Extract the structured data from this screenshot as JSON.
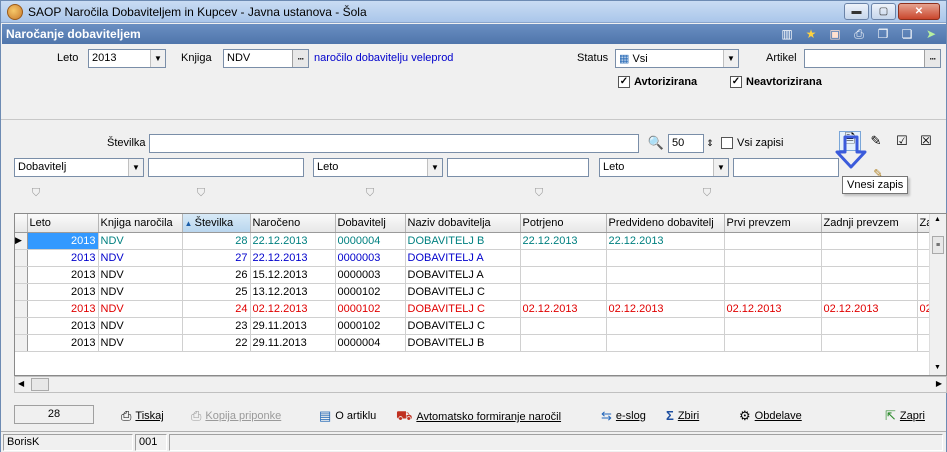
{
  "window": {
    "title": "SAOP Naročila Dobaviteljem in Kupcev - Javna ustanova - Šola",
    "minimize": "▬",
    "maximize": "▢",
    "close": "✕"
  },
  "header": {
    "title": "Naročanje dobaviteljem"
  },
  "form": {
    "leto_label": "Leto",
    "leto_value": "2013",
    "knjiga_label": "Knjiga",
    "knjiga_value": "NDV",
    "knjiga_desc": "naročilo dobavitelju veleprod",
    "status_label": "Status",
    "status_value": "Vsi",
    "artikel_label": "Artikel",
    "artikel_value": "",
    "avtorizirana_label": "Avtorizirana",
    "avtorizirana_checked": "✓",
    "neavtorizirana_label": "Neavtorizirana",
    "neavtorizirana_checked": "✓"
  },
  "search": {
    "stevilka_label": "Številka",
    "stevilka_value": "",
    "count_value": "50",
    "vsi_zapisi_label": "Vsi zapisi"
  },
  "filters": {
    "f1_field": "Dobavitelj",
    "f2_field": "Leto",
    "f3_field": "Leto"
  },
  "tooltip": {
    "text": "Vnesi zapis"
  },
  "table": {
    "columns": [
      "Leto",
      "Knjiga naročila",
      "Številka",
      "Naročeno",
      "Dobavitelj",
      "Naziv dobavitelja",
      "Potrjeno",
      "Predvideno dobavitelj",
      "Prvi prevzem",
      "Zadnji prevzem",
      "Za"
    ],
    "rows": [
      {
        "leto": "2013",
        "knjiga": "NDV",
        "stevilka": "28",
        "naroceno": "22.12.2013",
        "dobavitelj": "0000004",
        "naziv": "DOBAVITELJ  B",
        "potrjeno": "22.12.2013",
        "predvideno": "22.12.2013",
        "prvi": "",
        "zadnji": "",
        "za": "",
        "color": "#008080"
      },
      {
        "leto": "2013",
        "knjiga": "NDV",
        "stevilka": "27",
        "naroceno": "22.12.2013",
        "dobavitelj": "0000003",
        "naziv": "DOBAVITELJ  A",
        "potrjeno": "",
        "predvideno": "",
        "prvi": "",
        "zadnji": "",
        "za": "",
        "color": "#0000cc"
      },
      {
        "leto": "2013",
        "knjiga": "NDV",
        "stevilka": "26",
        "naroceno": "15.12.2013",
        "dobavitelj": "0000003",
        "naziv": "DOBAVITELJ  A",
        "potrjeno": "",
        "predvideno": "",
        "prvi": "",
        "zadnji": "",
        "za": "",
        "color": "#000000"
      },
      {
        "leto": "2013",
        "knjiga": "NDV",
        "stevilka": "25",
        "naroceno": "13.12.2013",
        "dobavitelj": "0000102",
        "naziv": "DOBAVITELJ C",
        "potrjeno": "",
        "predvideno": "",
        "prvi": "",
        "zadnji": "",
        "za": "",
        "color": "#000000"
      },
      {
        "leto": "2013",
        "knjiga": "NDV",
        "stevilka": "24",
        "naroceno": "02.12.2013",
        "dobavitelj": "0000102",
        "naziv": "DOBAVITELJ C",
        "potrjeno": "02.12.2013",
        "predvideno": "02.12.2013",
        "prvi": "02.12.2013",
        "zadnji": "02.12.2013",
        "za": "02",
        "color": "#e00000"
      },
      {
        "leto": "2013",
        "knjiga": "NDV",
        "stevilka": "23",
        "naroceno": "29.11.2013",
        "dobavitelj": "0000102",
        "naziv": "DOBAVITELJ C",
        "potrjeno": "",
        "predvideno": "",
        "prvi": "",
        "zadnji": "",
        "za": "",
        "color": "#000000"
      },
      {
        "leto": "2013",
        "knjiga": "NDV",
        "stevilka": "22",
        "naroceno": "29.11.2013",
        "dobavitelj": "0000004",
        "naziv": "DOBAVITELJ  B",
        "potrjeno": "",
        "predvideno": "",
        "prvi": "",
        "zadnji": "",
        "za": "",
        "color": "#000000"
      }
    ]
  },
  "bottom": {
    "count": "28",
    "tiskaj": "Tiskaj",
    "kopija": "Kopija priponke",
    "o_artiklu": "O artiklu",
    "avtomatsko": "Avtomatsko formiranje naročil",
    "eslog": "e-slog",
    "zbiri": "Zbiri",
    "obdelave": "Obdelave",
    "zapri": "Zapri"
  },
  "status": {
    "user": "BorisK",
    "code": "001"
  },
  "colors": {
    "header_bg": "#5b81b8",
    "selection": "#3399ff",
    "arrow": "#3b5bdb"
  }
}
